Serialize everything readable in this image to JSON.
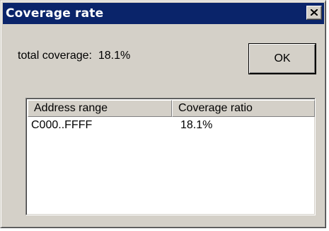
{
  "window": {
    "title": "Coverage rate"
  },
  "summary": {
    "label": "total coverage:",
    "value": "18.1%"
  },
  "buttons": {
    "ok": "OK"
  },
  "table": {
    "columns": [
      "Address range",
      "Coverage ratio"
    ],
    "rows": [
      {
        "address_range": "C000..FFFF",
        "coverage_ratio": "18.1%"
      }
    ]
  },
  "colors": {
    "titlebar": "#0a246a",
    "face": "#d4d0c8"
  },
  "icons": {
    "close": "close-icon"
  }
}
